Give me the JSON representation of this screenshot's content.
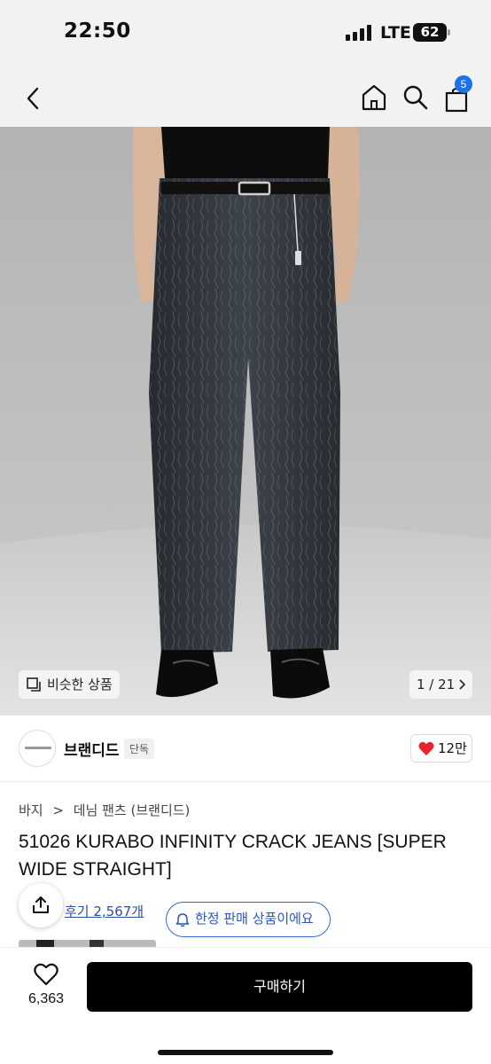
{
  "status_bar": {
    "time": "22:50",
    "network": "LTE",
    "battery": "62"
  },
  "nav": {
    "back_icon": "chevron-left-icon",
    "home_icon": "home-icon",
    "search_icon": "search-icon",
    "cart_icon": "shopping-bag-icon",
    "cart_badge": "5"
  },
  "image": {
    "similar_label": "비슷한 상품",
    "counter": "1 / 21"
  },
  "brand": {
    "name": "브랜디드",
    "tag": "단독",
    "likes": "12만"
  },
  "product": {
    "breadcrumb": [
      "바지",
      "데님 팬츠 (브랜디드)"
    ],
    "title": "51026 KURABO INFINITY CRACK JEANS [SUPER WIDE STRAIGHT]",
    "review_link": "후기 2,567개",
    "limited_label": "한정 판매 상품이에요"
  },
  "bottom": {
    "wish_count": "6,363",
    "buy_label": "구매하기"
  },
  "colors": {
    "accent_blue": "#3a66d6",
    "badge_blue": "#1a73e8",
    "like_red": "#e8222e",
    "buy_black": "#000000"
  }
}
